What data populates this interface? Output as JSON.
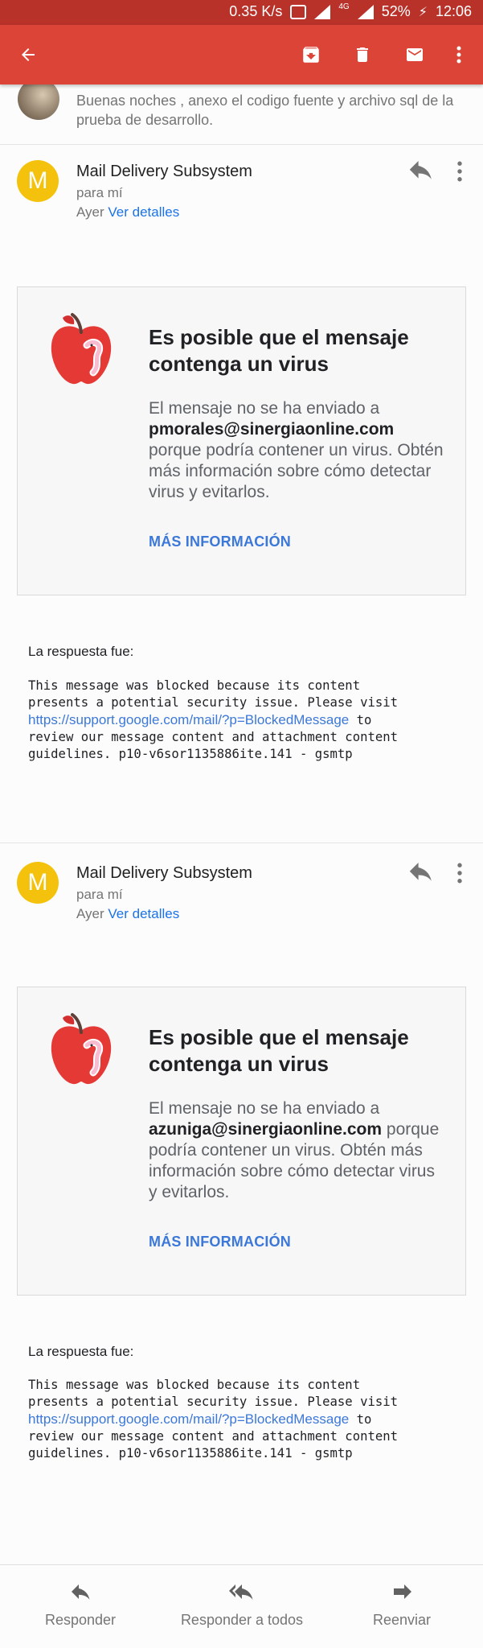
{
  "status_bar": {
    "speed": "0.35 K/s",
    "network": "4G",
    "battery": "52%",
    "time": "12:06"
  },
  "toolbar": {
    "back_icon": "arrow-left-icon",
    "archive_icon": "archive-icon",
    "delete_icon": "trash-icon",
    "mark_unread_icon": "mail-icon",
    "more_icon": "more-vertical-icon"
  },
  "previous_message": {
    "snippet": "Buenas noches , anexo el codigo fuente y archivo sql de la prueba de desarrollo."
  },
  "messages": [
    {
      "avatar_letter": "M",
      "sender": "Mail Delivery Subsystem",
      "to": "para mí",
      "date": "Ayer",
      "details_link": "Ver detalles",
      "card": {
        "title": "Es posible que el mensaje contenga un virus",
        "body_prefix": "El mensaje no se ha enviado a",
        "recipient": "pmorales@sinergiaonline.com",
        "body_suffix": "porque podría contener un virus. Obtén más información sobre cómo detectar virus y evitarlos.",
        "more_label": "MÁS INFORMACIÓN"
      },
      "response_label": "La respuesta fue:",
      "response_line1": "This message was blocked because its content",
      "response_line2": "presents a potential security issue. Please visit",
      "response_link": "https://support.google.com/mail/?p=BlockedMessage",
      "response_after_link": " to",
      "response_line4": "review our message content and attachment content",
      "response_line5": "guidelines. p10-v6sor1135886ite.141 - gsmtp"
    },
    {
      "avatar_letter": "M",
      "sender": "Mail Delivery Subsystem",
      "to": "para mí",
      "date": "Ayer",
      "details_link": "Ver detalles",
      "card": {
        "title": "Es posible que el mensaje contenga un virus",
        "body_prefix": "El mensaje no se ha enviado a",
        "recipient": "azuniga@sinergiaonline.com",
        "body_suffix": "porque podría contener un virus. Obtén más información sobre cómo detectar virus y evitarlos.",
        "more_label": "MÁS INFORMACIÓN"
      },
      "response_label": "La respuesta fue:",
      "response_line1": "This message was blocked because its content",
      "response_line2": "presents a potential security issue. Please visit",
      "response_link": "https://support.google.com/mail/?p=BlockedMessage",
      "response_after_link": " to",
      "response_line4": "review our message content and attachment content",
      "response_line5": "guidelines. p10-v6sor1135886ite.141 - gsmtp"
    }
  ],
  "bottom_bar": {
    "reply_label": "Responder",
    "reply_all_label": "Responder a todos",
    "forward_label": "Reenviar"
  },
  "colors": {
    "toolbar": "#db4437",
    "status_bar": "#b8322a",
    "avatar": "#f4c20d",
    "link": "#1a73e8",
    "accent": "#3c78d8"
  }
}
